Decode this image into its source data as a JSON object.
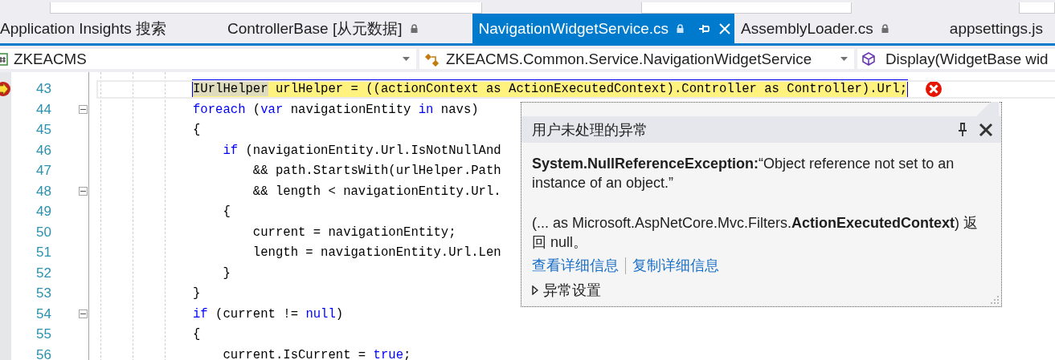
{
  "tabs": [
    {
      "label": "Application Insights 搜索",
      "selected": false,
      "locked": false
    },
    {
      "label": "ControllerBase [从元数据]",
      "selected": false,
      "locked": true
    },
    {
      "label": "NavigationWidgetService.cs",
      "selected": true,
      "locked": true
    },
    {
      "label": "AssemblyLoader.cs",
      "selected": false,
      "locked": true
    },
    {
      "label": "appsettings.js",
      "selected": false,
      "locked": false
    }
  ],
  "nav_bar": {
    "project": "ZKEACMS",
    "type": "ZKEACMS.Common.Service.NavigationWidgetService",
    "member": "Display(WidgetBase wid"
  },
  "editor": {
    "lines": [
      {
        "number": "43",
        "current": true,
        "error": true,
        "collapsible": false,
        "tokens": [
          {
            "text": "IUrlHelper",
            "kind": "reference"
          },
          {
            "text": " urlHelper = ((actionContext ",
            "kind": "plain"
          },
          {
            "text": "as",
            "kind": "plain"
          },
          {
            "text": " ActionExecutedContext).Controller as Controller).Url;",
            "kind": "plain"
          }
        ]
      },
      {
        "number": "44",
        "current": false,
        "error": false,
        "collapsible": true,
        "tokens": [
          {
            "text": "foreach",
            "kind": "keyword"
          },
          {
            "text": " (",
            "kind": "plain"
          },
          {
            "text": "var",
            "kind": "keyword"
          },
          {
            "text": " navigationEntity ",
            "kind": "plain"
          },
          {
            "text": "in",
            "kind": "keyword"
          },
          {
            "text": " navs)",
            "kind": "plain"
          }
        ]
      },
      {
        "number": "45",
        "current": false,
        "error": false,
        "collapsible": false,
        "tokens": [
          {
            "text": "{",
            "kind": "plain"
          }
        ]
      },
      {
        "number": "46",
        "current": false,
        "error": false,
        "collapsible": false,
        "tokens": [
          {
            "text": "    if",
            "kind": "keyword"
          },
          {
            "text": " (navigationEntity.Url.IsNotNullAnd",
            "kind": "plain"
          }
        ]
      },
      {
        "number": "47",
        "current": false,
        "error": false,
        "collapsible": false,
        "tokens": [
          {
            "text": "        && path.StartsWith(urlHelper.Path",
            "kind": "plain"
          }
        ]
      },
      {
        "number": "48",
        "current": false,
        "error": false,
        "collapsible": true,
        "tokens": [
          {
            "text": "        && length < navigationEntity.Url.",
            "kind": "plain"
          }
        ]
      },
      {
        "number": "49",
        "current": false,
        "error": false,
        "collapsible": false,
        "tokens": [
          {
            "text": "    {",
            "kind": "plain"
          }
        ]
      },
      {
        "number": "50",
        "current": false,
        "error": false,
        "collapsible": false,
        "tokens": [
          {
            "text": "        current = navigationEntity;",
            "kind": "plain"
          }
        ]
      },
      {
        "number": "51",
        "current": false,
        "error": false,
        "collapsible": false,
        "tokens": [
          {
            "text": "        length = navigationEntity.Url.Len",
            "kind": "plain"
          }
        ]
      },
      {
        "number": "52",
        "current": false,
        "error": false,
        "collapsible": false,
        "tokens": [
          {
            "text": "    }",
            "kind": "plain"
          }
        ]
      },
      {
        "number": "53",
        "current": false,
        "error": false,
        "collapsible": false,
        "tokens": [
          {
            "text": "}",
            "kind": "plain"
          }
        ]
      },
      {
        "number": "54",
        "current": false,
        "error": false,
        "collapsible": true,
        "tokens": [
          {
            "text": "if",
            "kind": "keyword"
          },
          {
            "text": " (current != ",
            "kind": "plain"
          },
          {
            "text": "null",
            "kind": "keyword"
          },
          {
            "text": ")",
            "kind": "plain"
          }
        ]
      },
      {
        "number": "55",
        "current": false,
        "error": false,
        "collapsible": false,
        "tokens": [
          {
            "text": "{",
            "kind": "plain"
          }
        ]
      },
      {
        "number": "56",
        "current": false,
        "error": false,
        "collapsible": false,
        "tokens": [
          {
            "text": "    current.IsCurrent = ",
            "kind": "plain"
          },
          {
            "text": "true",
            "kind": "keyword"
          },
          {
            "text": ";",
            "kind": "plain"
          }
        ]
      }
    ]
  },
  "exception_popup": {
    "title": "用户未处理的异常",
    "message": "**System.NullReferenceException:**“Object reference not set to an instance of an object.”",
    "detail": "(... as Microsoft.AspNetCore.Mvc.Filters.**ActionExecutedContext**) 返回 null。",
    "links": [
      "查看详细信息",
      "复制详细信息"
    ],
    "settings": {
      "label": "异常设置",
      "expanded": false
    }
  }
}
